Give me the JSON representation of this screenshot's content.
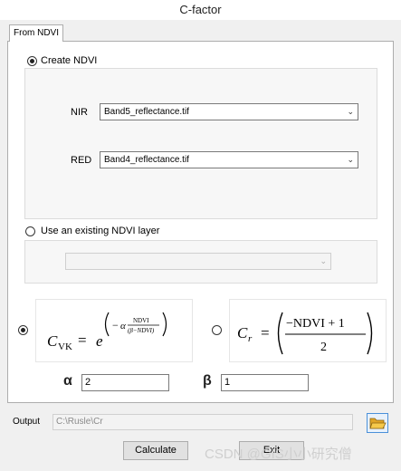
{
  "window": {
    "title": "C-factor"
  },
  "tabs": [
    {
      "label": "From NDVI"
    }
  ],
  "create_ndvi": {
    "label": "Create NDVI",
    "selected": true,
    "nir": {
      "label": "NIR",
      "value": "Band5_reflectance.tif"
    },
    "red": {
      "label": "RED",
      "value": "Band4_reflectance.tif"
    }
  },
  "existing_ndvi": {
    "label": "Use an existing NDVI layer",
    "selected": false,
    "value": ""
  },
  "formulas": {
    "option1": {
      "selected": true,
      "text": "C_VK = e^(−α·NDVI/(β−NDVI))"
    },
    "option2": {
      "selected": false,
      "text": "C_r = ((−NDVI + 1)/2)"
    }
  },
  "params": {
    "alpha": {
      "label": "α",
      "value": "2"
    },
    "beta": {
      "label": "β",
      "value": "1"
    }
  },
  "output": {
    "label": "Output",
    "value": "C:\\Rusle\\Cr"
  },
  "buttons": {
    "calculate": "Calculate",
    "exit": "Exit"
  },
  "watermark": "CSDN @GIS小小研究僧",
  "icons": {
    "folder": "folder-open-icon"
  }
}
